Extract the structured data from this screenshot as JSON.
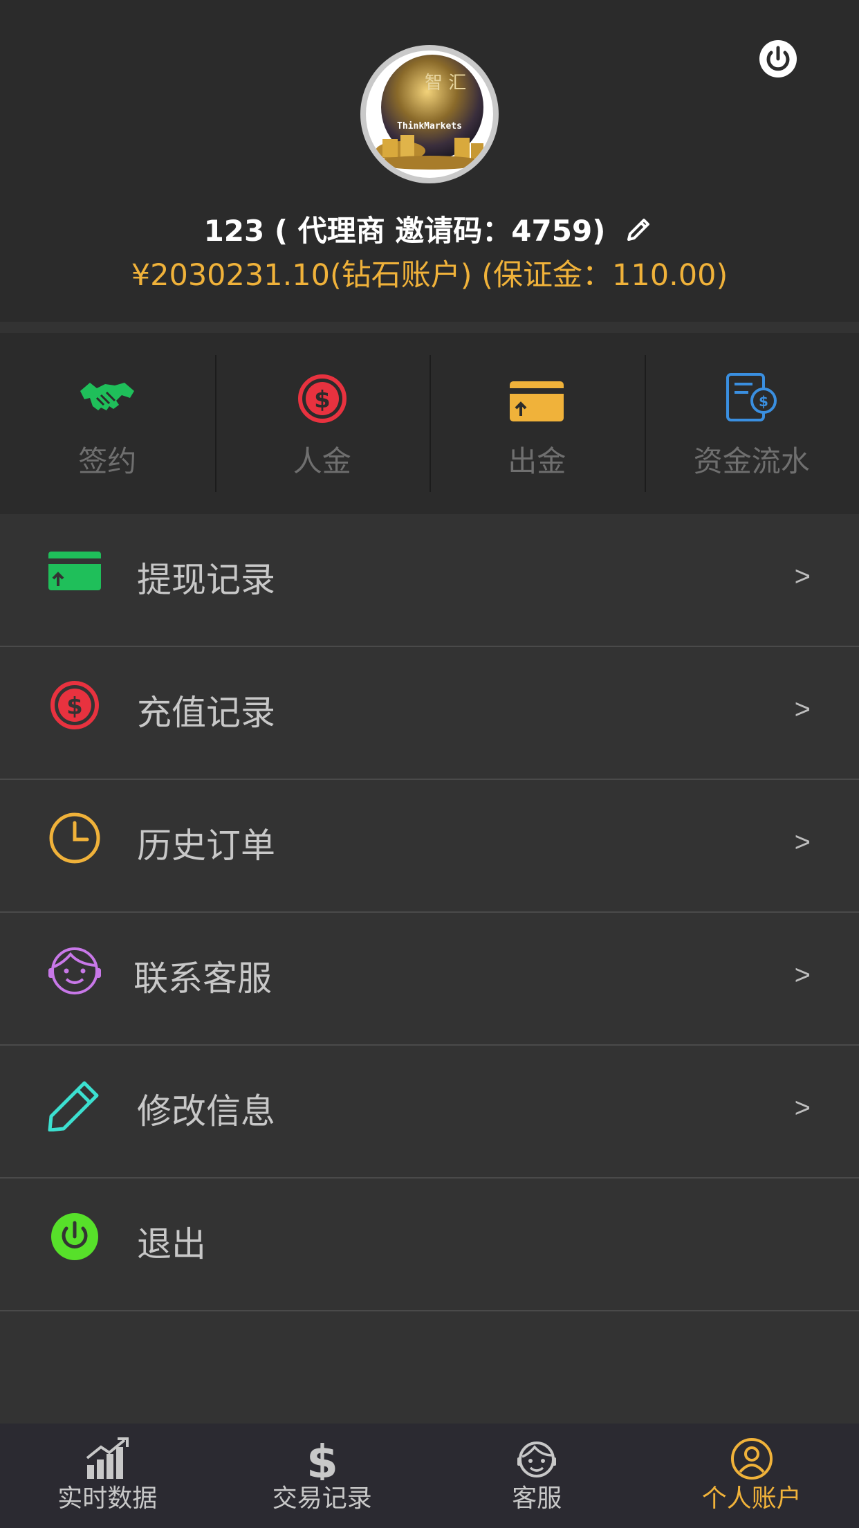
{
  "profile": {
    "name_line": "123 ( 代理商 邀请码：4759)",
    "balance_line": "¥2030231.10(钻石账户) (保证金：110.00)",
    "avatar_logo_cn": "智 汇",
    "avatar_logo_en": "ThinkMarkets"
  },
  "quick_actions": [
    {
      "label": "签约",
      "icon": "handshake-icon",
      "color": "#1fbf5a"
    },
    {
      "label": "人金",
      "icon": "dollar-circle-icon",
      "color": "#e8323f"
    },
    {
      "label": "出金",
      "icon": "card-withdraw-icon",
      "color": "#f0b23a"
    },
    {
      "label": "资金流水",
      "icon": "statement-icon",
      "color": "#3a8fe0"
    }
  ],
  "menu": [
    {
      "label": "提现记录",
      "arrow": ">",
      "icon": "card-withdraw-icon",
      "color": "#1fbf5a"
    },
    {
      "label": "充值记录",
      "arrow": ">",
      "icon": "dollar-circle-icon",
      "color": "#e8323f"
    },
    {
      "label": "历史订单",
      "arrow": ">",
      "icon": "clock-icon",
      "color": "#f0b23a"
    },
    {
      "label": "联系客服",
      "arrow": ">",
      "icon": "customer-service-icon",
      "color": "#c878e8"
    },
    {
      "label": "修改信息",
      "arrow": ">",
      "icon": "pencil-icon",
      "color": "#3ce0d0"
    },
    {
      "label": "退出",
      "arrow": "",
      "icon": "power-icon",
      "color": "#57e02a"
    }
  ],
  "tabs": [
    {
      "label": "实时数据",
      "icon": "chart-icon",
      "active": false
    },
    {
      "label": "交易记录",
      "icon": "dollar-icon",
      "active": false
    },
    {
      "label": "客服",
      "icon": "face-icon",
      "active": false
    },
    {
      "label": "个人账户",
      "icon": "user-icon",
      "active": true
    }
  ],
  "colors": {
    "accent": "#f0b23a",
    "background": "#333333",
    "header": "#2b2b2b",
    "tabbar": "#2b2a31"
  }
}
